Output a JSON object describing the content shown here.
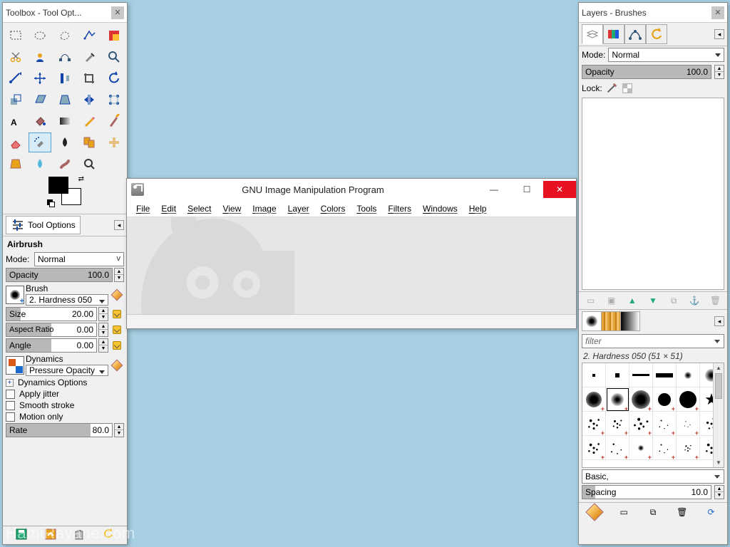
{
  "toolbox": {
    "title": "Toolbox - Tool Opt...",
    "tools": [
      "rect-select",
      "ellipse-select",
      "free-select",
      "fuzzy-select",
      "by-color-select",
      "scissors",
      "foreground-select",
      "paths",
      "color-picker",
      "zoom",
      "measure",
      "move",
      "align",
      "crop",
      "rotate",
      "scale",
      "shear",
      "perspective",
      "flip",
      "cage",
      "text",
      "bucket-fill",
      "blend",
      "pencil",
      "paintbrush",
      "eraser",
      "airbrush",
      "ink",
      "clone",
      "heal",
      "perspective-clone",
      "blur-sharpen",
      "smudge",
      "dodge-burn"
    ],
    "selected_tool_index": 26,
    "tab_label": "Tool Options",
    "active_tool_name": "Airbrush",
    "mode_label": "Mode:",
    "mode_value": "Normal",
    "opacity": {
      "label": "Opacity",
      "value": "100.0",
      "fill": 100
    },
    "brush": {
      "label": "Brush",
      "name": "2. Hardness 050"
    },
    "size": {
      "label": "Size",
      "value": "20.00",
      "fill": 16
    },
    "aspect": {
      "label": "Aspect Ratio",
      "value": "0.00",
      "fill": 50
    },
    "angle": {
      "label": "Angle",
      "value": "0.00",
      "fill": 50
    },
    "dynamics": {
      "label": "Dynamics",
      "name": "Pressure Opacity"
    },
    "dyn_options": "Dynamics Options",
    "jitter": "Apply jitter",
    "smooth": "Smooth stroke",
    "motion": "Motion only",
    "rate": {
      "label": "Rate",
      "value": "80.0",
      "fill": 80
    }
  },
  "main": {
    "title": "GNU Image Manipulation Program",
    "menus": [
      "File",
      "Edit",
      "Select",
      "View",
      "Image",
      "Layer",
      "Colors",
      "Tools",
      "Filters",
      "Windows",
      "Help"
    ]
  },
  "right": {
    "title": "Layers - Brushes",
    "layer_tabs": [
      "layers",
      "channels",
      "paths",
      "undo"
    ],
    "mode_label": "Mode:",
    "mode_value": "Normal",
    "opacity": {
      "label": "Opacity",
      "value": "100.0",
      "fill": 100
    },
    "lock_label": "Lock:",
    "brush_filter_placeholder": "filter",
    "brush_caption": "2. Hardness 050 (51 × 51)",
    "preset": "Basic,",
    "spacing": {
      "label": "Spacing",
      "value": "10.0",
      "fill": 10
    }
  },
  "watermark": "HamiRayane.com"
}
